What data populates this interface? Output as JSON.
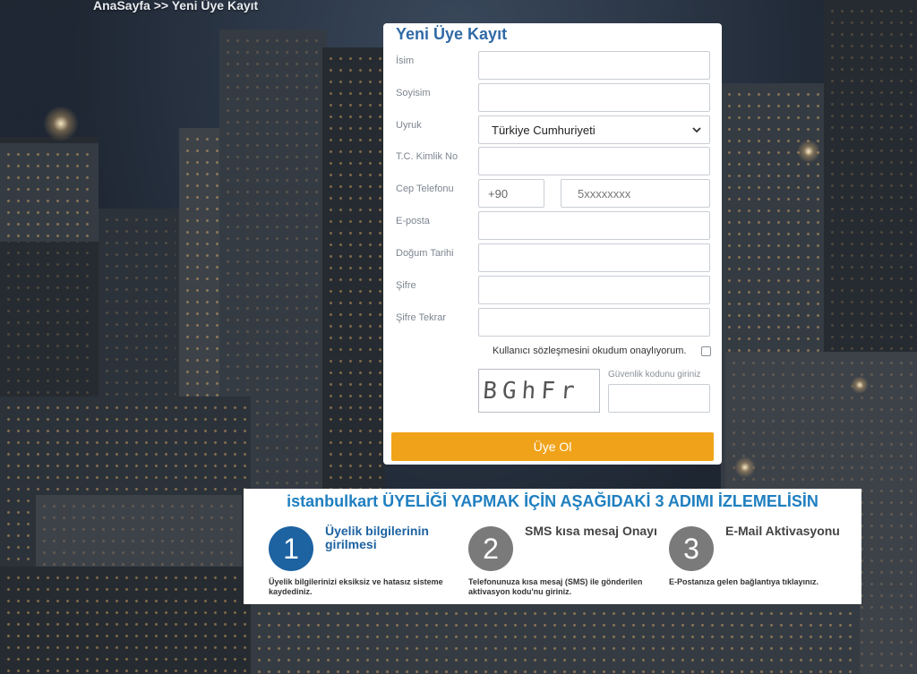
{
  "breadcrumb": {
    "home": "AnaSayfa",
    "separator": ">>",
    "current": "Yeni Üye Kayıt"
  },
  "form": {
    "title": "Yeni Üye Kayıt",
    "labels": {
      "first_name": "İsim",
      "last_name": "Soyisim",
      "nationality": "Uyruk",
      "tc_no": "T.C. Kimlik No",
      "phone": "Cep Telefonu",
      "email": "E-posta",
      "birth_date": "Doğum Tarihi",
      "password": "Şifre",
      "password_repeat": "Şifre Tekrar"
    },
    "nationality_value": "Türkiye Cumhuriyeti",
    "phone_code_value": "+90",
    "phone_placeholder": "5xxxxxxxx",
    "agreement_text": "Kullanıcı sözleşmesini okudum onaylıyorum.",
    "captcha_text": "BGhFr",
    "captcha_label": "Güvenlik kodunu giriniz",
    "submit_label": "Üye Ol"
  },
  "steps": {
    "title": "istanbulkart ÜYELİĞİ YAPMAK İÇİN AŞAĞIDAKİ 3 ADIMI İZLEMELİSİN",
    "items": [
      {
        "number": "1",
        "title": "Üyelik bilgilerinin girilmesi",
        "description": "Üyelik bilgilerinizi eksiksiz ve hatasız sisteme kaydediniz.",
        "color": "#1d62a1"
      },
      {
        "number": "2",
        "title": "SMS kısa mesaj Onayı",
        "description": "Telefonunuza kısa mesaj (SMS) ile gönderilen aktivasyon kodu'nu giriniz.",
        "color": "#7a7a7a"
      },
      {
        "number": "3",
        "title": "E-Mail Aktivasyonu",
        "description": "E-Postanıza gelen bağlantıya tıklayınız.",
        "color": "#7a7a7a"
      }
    ]
  },
  "colors": {
    "accent_blue": "#2f6aa6",
    "submit_orange": "#f0a31a",
    "steps_title_blue": "#1f7fc0"
  },
  "icons": {
    "select_chevron": "chevron-down-icon"
  }
}
